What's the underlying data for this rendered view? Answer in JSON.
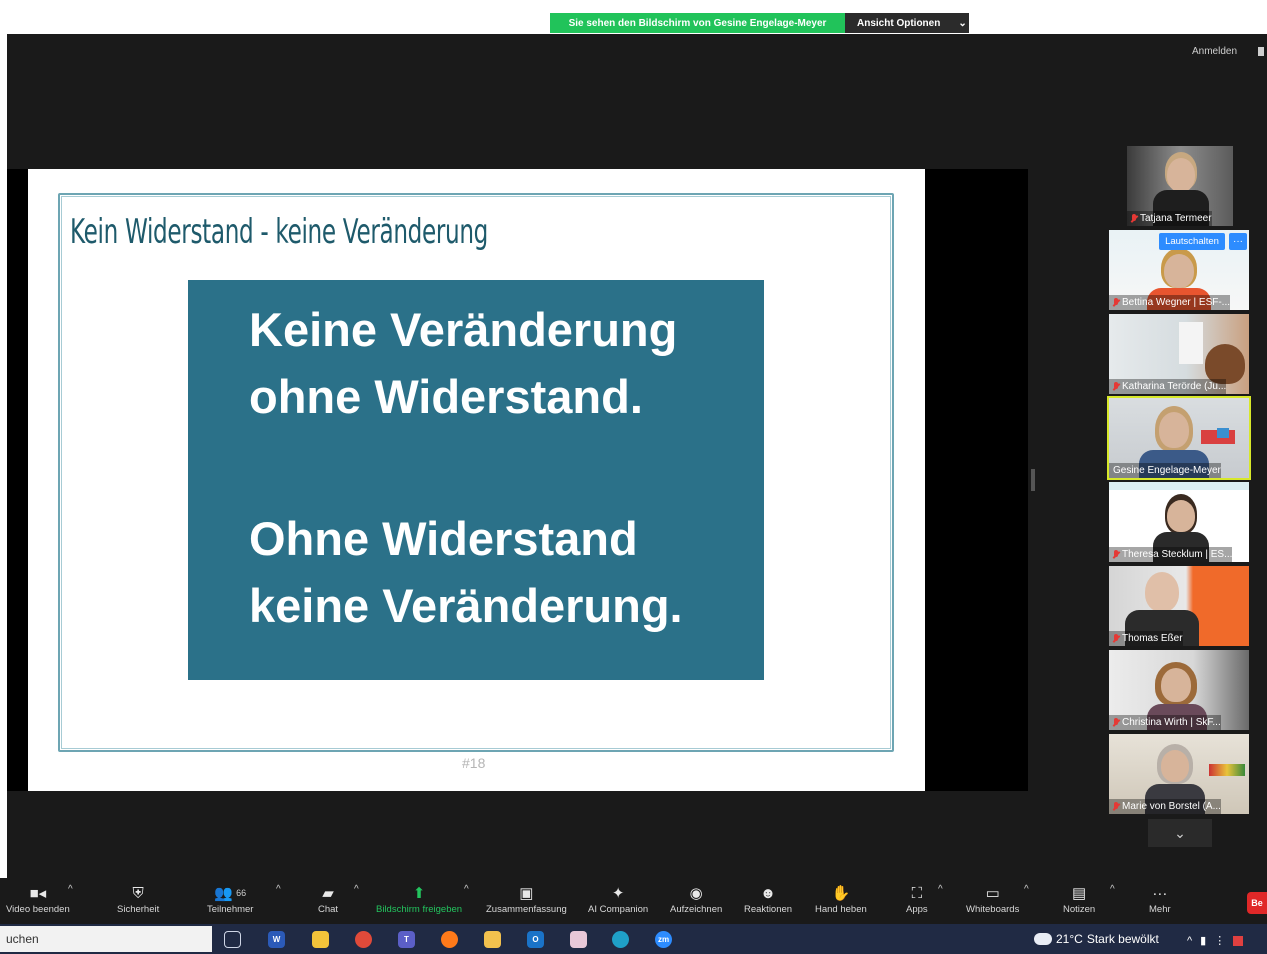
{
  "share_banner": {
    "text": "Sie sehen den Bildschirm von Gesine Engelage-Meyer",
    "options_label": "Ansicht Optionen",
    "options_caret": "⌄"
  },
  "header": {
    "signin_label": "Anmelden"
  },
  "slide": {
    "title": "Kein Widerstand - keine Veränderung",
    "quote_lines": [
      "Keine Veränderung",
      "ohne Widerstand.",
      "Ohne Widerstand",
      "keine Veränderung."
    ],
    "slide_number": "#18"
  },
  "participants": {
    "unmute_label": "Lautschalten",
    "more_label": "···",
    "scroll_down_icon": "chevron-down-icon",
    "tiles": [
      {
        "name": "Tatjana Termeer",
        "muted": true
      },
      {
        "name": "Bettina Wegner | ESF-...",
        "muted": true
      },
      {
        "name": "Katharina Terörde (Ju...",
        "muted": true
      },
      {
        "name": "Gesine Engelage-Meyer",
        "muted": false,
        "active": true
      },
      {
        "name": "Theresa Stecklum | ES...",
        "muted": true
      },
      {
        "name": "Thomas Eßer",
        "muted": true
      },
      {
        "name": "Christina Wirth | SkF...",
        "muted": true
      },
      {
        "name": "Marie von Borstel (A...",
        "muted": true
      }
    ]
  },
  "toolbar": {
    "video": "Video beenden",
    "security": "Sicherheit",
    "participants": "Teilnehmer",
    "participants_count": "66",
    "chat": "Chat",
    "share": "Bildschirm freigeben",
    "summary": "Zusammenfassung",
    "ai": "AI Companion",
    "record": "Aufzeichnen",
    "reactions": "Reaktionen",
    "hand": "Hand heben",
    "apps": "Apps",
    "whiteboards": "Whiteboards",
    "notes": "Notizen",
    "more": "Mehr",
    "end": "Be"
  },
  "taskbar": {
    "search_text": "uchen",
    "weather_temp": "21°C",
    "weather_text": "Stark bewölkt",
    "zoom_label": "zm"
  },
  "colors": {
    "accent_green": "#21c35a",
    "slide_box": "#2b7189",
    "slide_title": "#1e5a6b",
    "zoom_blue": "#2d8cff",
    "active_border": "#d7e82a"
  }
}
